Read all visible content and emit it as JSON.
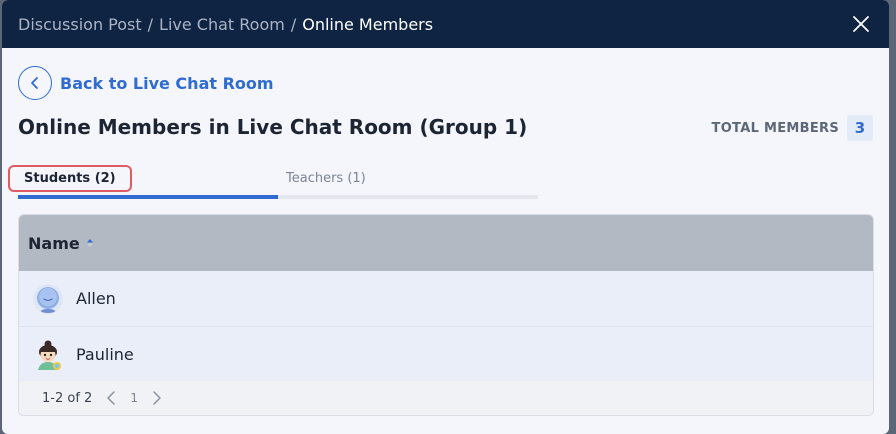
{
  "breadcrumb": {
    "items": [
      "Discussion Post",
      "Live Chat Room"
    ],
    "current": "Online Members",
    "separator": "/"
  },
  "back": {
    "label": "Back to Live Chat Room"
  },
  "title": "Online Members in Live Chat Room (Group 1)",
  "total": {
    "label": "TOTAL MEMBERS",
    "count": "3"
  },
  "tabs": [
    {
      "label": "Students (2)",
      "active": true
    },
    {
      "label": "Teachers (1)",
      "active": false
    }
  ],
  "table": {
    "column_name": "Name",
    "rows": [
      {
        "name": "Allen",
        "avatar": "blue-bubble-avatar"
      },
      {
        "name": "Pauline",
        "avatar": "girl-avatar"
      }
    ]
  },
  "pager": {
    "range": "1-2 of 2",
    "page": "1"
  },
  "colors": {
    "header_bg": "#0f2342",
    "accent": "#2f6bd1",
    "highlight": "#e05c63"
  }
}
